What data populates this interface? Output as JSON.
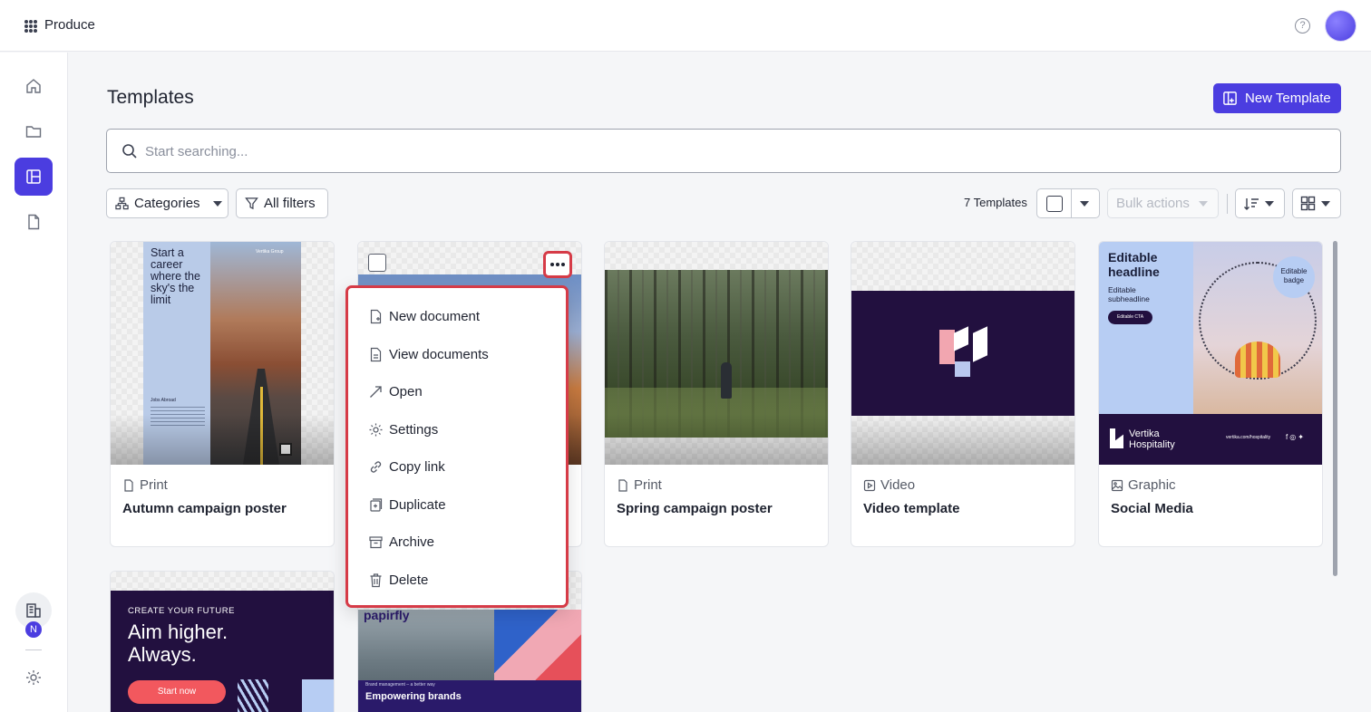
{
  "app": {
    "name": "Produce"
  },
  "page": {
    "title": "Templates",
    "new_template_label": "New Template"
  },
  "search": {
    "placeholder": "Start searching..."
  },
  "filters": {
    "categories_label": "Categories",
    "all_filters_label": "All filters"
  },
  "toolbar": {
    "count_label": "7 Templates",
    "bulk_actions_label": "Bulk actions"
  },
  "sidebar": {
    "org_badge": "N"
  },
  "colors": {
    "accent": "#4b3de0",
    "highlight": "#d63b47"
  },
  "cards": [
    {
      "type": "Print",
      "title": "Autumn campaign poster",
      "icon": "document-icon"
    },
    {
      "type": "Print",
      "title": "Spring campaign poster",
      "icon": "document-icon"
    },
    {
      "type": "Video",
      "title": "Video template",
      "icon": "video-icon"
    },
    {
      "type": "Graphic",
      "title": "Social Media",
      "icon": "image-icon"
    }
  ],
  "thumb_text": {
    "autumn_headline": [
      "Start a",
      "career",
      "where the",
      "sky's the",
      "limit"
    ],
    "autumn_brand": "Vertika Group",
    "autumn_sub": "Jobs Abroad",
    "social_headline": [
      "Editable",
      "headline"
    ],
    "social_sub": [
      "Editable",
      "subheadline"
    ],
    "social_cta": "Editable CTA",
    "social_badge": [
      "Editable",
      "badge"
    ],
    "social_brand": [
      "Vertika",
      "Hospitality"
    ],
    "social_url": "vertika.com/hospitality",
    "create_kicker": "CREATE YOUR FUTURE",
    "create_headline": [
      "Aim higher.",
      "Always."
    ],
    "create_cta": "Start now",
    "papirfly_brand": "papirfly",
    "papirfly_kicker": "Brand management – a better way",
    "papirfly_headline": "Empowering brands"
  },
  "menu": {
    "items": [
      {
        "label": "New document",
        "icon": "new-document-icon"
      },
      {
        "label": "View documents",
        "icon": "documents-icon"
      },
      {
        "label": "Open",
        "icon": "open-arrow-icon"
      },
      {
        "label": "Settings",
        "icon": "settings-icon"
      },
      {
        "label": "Copy link",
        "icon": "link-icon"
      },
      {
        "label": "Duplicate",
        "icon": "duplicate-icon"
      },
      {
        "label": "Archive",
        "icon": "archive-icon"
      },
      {
        "label": "Delete",
        "icon": "trash-icon"
      }
    ]
  }
}
